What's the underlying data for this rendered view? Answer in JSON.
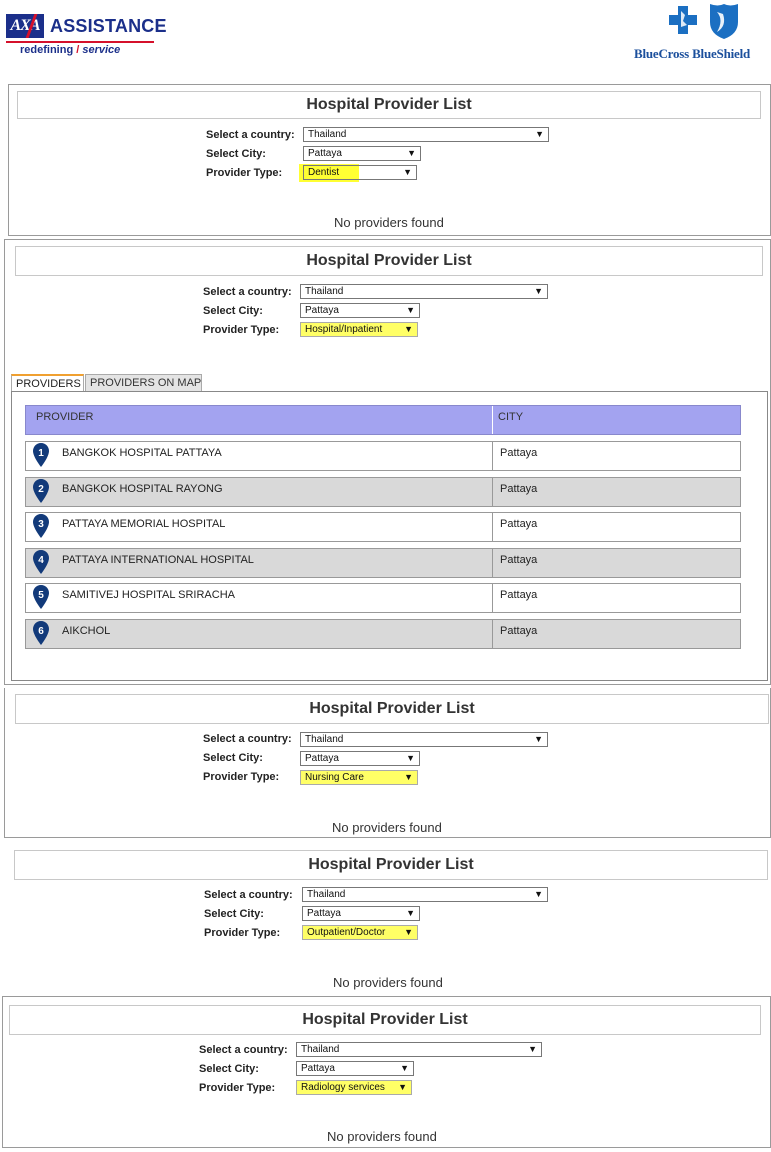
{
  "header": {
    "axa_mark": "AXA",
    "axa_name": "ASSISTANCE",
    "axa_tagline_1": "redefining",
    "axa_tagline_sep": "/",
    "axa_tagline_2": "service",
    "bcbs_name": "BlueCross BlueShield"
  },
  "labels": {
    "title": "Hospital Provider List",
    "country_label": "Select a country:",
    "city_label": "Select City:",
    "type_label": "Provider Type:",
    "no_providers": "No providers found"
  },
  "selections": {
    "country": "Thailand",
    "city": "Pattaya",
    "arrow": "▼"
  },
  "panels": [
    {
      "provider_type": "Dentist"
    },
    {
      "provider_type": "Hospital/Inpatient"
    },
    {
      "provider_type": "Nursing Care"
    },
    {
      "provider_type": "Outpatient/Doctor"
    },
    {
      "provider_type": "Radiology services"
    }
  ],
  "tabs": {
    "providers": "PROVIDERS",
    "providers_on_map": "PROVIDERS ON MAP"
  },
  "table": {
    "headers": {
      "provider": "PROVIDER",
      "city": "CITY"
    },
    "rows": [
      {
        "num": "1",
        "name": "BANGKOK HOSPITAL PATTAYA",
        "city": "Pattaya"
      },
      {
        "num": "2",
        "name": "BANGKOK HOSPITAL RAYONG",
        "city": "Pattaya"
      },
      {
        "num": "3",
        "name": "PATTAYA MEMORIAL HOSPITAL",
        "city": "Pattaya"
      },
      {
        "num": "4",
        "name": "PATTAYA INTERNATIONAL HOSPITAL",
        "city": "Pattaya"
      },
      {
        "num": "5",
        "name": "SAMITIVEJ HOSPITAL SRIRACHA",
        "city": "Pattaya"
      },
      {
        "num": "6",
        "name": "AIKCHOL",
        "city": "Pattaya"
      }
    ]
  },
  "colors": {
    "highlight": "#ffff33",
    "table_header": "#a3a3f0",
    "pin": "#123a7a"
  }
}
